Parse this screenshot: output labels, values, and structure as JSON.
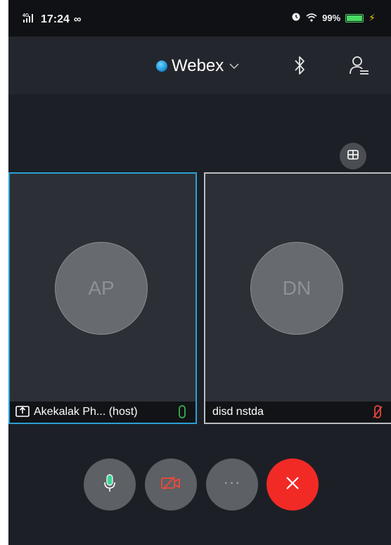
{
  "status_bar": {
    "signal_label": "4G",
    "time": "17:24",
    "extra_icon": "infinity-icon",
    "battery_percent": "99%",
    "battery_level": 0.99,
    "colors": {
      "battery": "#4cd964",
      "charging": "#f5c400"
    }
  },
  "header": {
    "app_name": "Webex",
    "icons": [
      "webex-logo-icon",
      "chevron-down-icon",
      "bluetooth-icon",
      "participants-icon"
    ]
  },
  "layout_toggle": {
    "icon": "grid-view-icon"
  },
  "participants": [
    {
      "initials": "AP",
      "name": "Akekalak Ph... (host)",
      "sharing_icon": "share-screen-icon",
      "mic_state": "unmuted",
      "mic_color": "#37b24d",
      "active_speaker": true
    },
    {
      "initials": "DN",
      "name": "disd nstda",
      "mic_state": "muted",
      "mic_color": "#e8473c",
      "active_speaker": false
    }
  ],
  "controls": {
    "mic": {
      "icon": "microphone-icon",
      "state": "unmuted"
    },
    "video": {
      "icon": "video-off-icon",
      "state": "off"
    },
    "more": {
      "icon": "more-icon",
      "label": "···"
    },
    "leave": {
      "icon": "close-icon",
      "color": "#f22a26"
    }
  }
}
